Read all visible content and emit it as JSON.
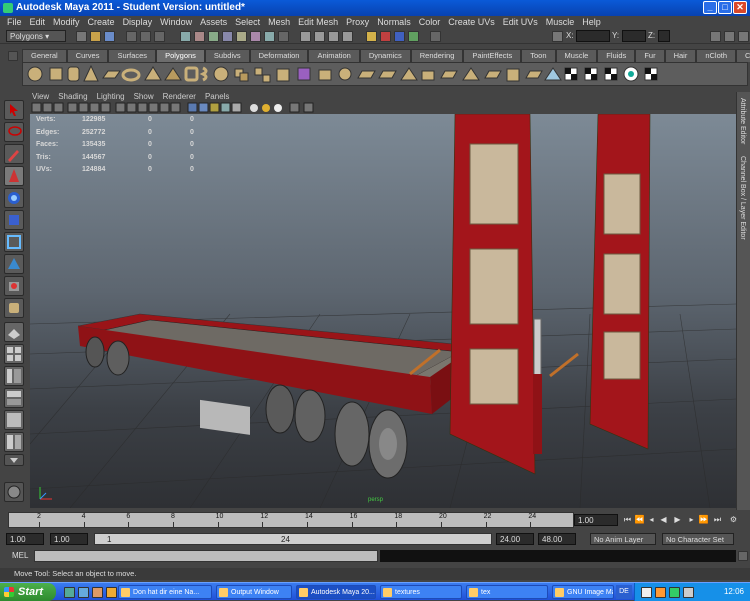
{
  "window": {
    "title": "Autodesk Maya 2011 - Student Version: untitled*"
  },
  "menubar": [
    "File",
    "Edit",
    "Modify",
    "Create",
    "Display",
    "Window",
    "Assets",
    "Select",
    "Mesh",
    "Edit Mesh",
    "Proxy",
    "Normals",
    "Color",
    "Create UVs",
    "Edit UVs",
    "Muscle",
    "Help"
  ],
  "statusline": {
    "menuset": "Polygons",
    "x_label": "X:",
    "y_label": "Y:",
    "z_label": "Z:"
  },
  "shelf_tabs": [
    "General",
    "Curves",
    "Surfaces",
    "Polygons",
    "Subdivs",
    "Deformation",
    "Animation",
    "Dynamics",
    "Rendering",
    "PaintEffects",
    "Toon",
    "Muscle",
    "Fluids",
    "Fur",
    "Hair",
    "nCloth",
    "Custom"
  ],
  "active_shelf_tab": "Polygons",
  "panel_menu": [
    "View",
    "Shading",
    "Lighting",
    "Show",
    "Renderer",
    "Panels"
  ],
  "hud": {
    "rows": [
      {
        "label": "Verts:",
        "v1": "122985",
        "v2": "0",
        "v3": "0"
      },
      {
        "label": "Edges:",
        "v1": "252772",
        "v2": "0",
        "v3": "0"
      },
      {
        "label": "Faces:",
        "v1": "135435",
        "v2": "0",
        "v3": "0"
      },
      {
        "label": "Tris:",
        "v1": "144567",
        "v2": "0",
        "v3": "0"
      },
      {
        "label": "UVs:",
        "v1": "124884",
        "v2": "0",
        "v3": "0"
      }
    ],
    "camera": "persp"
  },
  "right_strip": {
    "attr_editor": "Attribute Editor",
    "channel_box": "Channel Box / Layer Editor"
  },
  "timeline": {
    "ticks": [
      "2",
      "4",
      "6",
      "8",
      "10",
      "12",
      "14",
      "16",
      "18",
      "20",
      "22",
      "24"
    ],
    "start_marker": "1",
    "current_frame": "1.00"
  },
  "range": {
    "start": "1.00",
    "start2": "1.00",
    "range_start": "1",
    "range_end": "24",
    "end": "24.00",
    "end2": "48.00",
    "anim_layer": "No Anim Layer",
    "character": "No Character Set"
  },
  "mel": {
    "label": "MEL"
  },
  "helpline": "Move Tool: Select an object to move.",
  "taskbar": {
    "start": "Start",
    "items": [
      "Don hat dir eine Na...",
      "Output Window",
      "Autodesk Maya 20...",
      "textures",
      "tex",
      "GNU Image Manipul..."
    ],
    "active_index": 2,
    "language": "DE",
    "clock": "12:06"
  },
  "colors": {
    "trailer": "#a0141a",
    "viewport_top": "#7d8a96",
    "viewport_bottom": "#2e3034",
    "taskbar": "#2a5fe0"
  }
}
